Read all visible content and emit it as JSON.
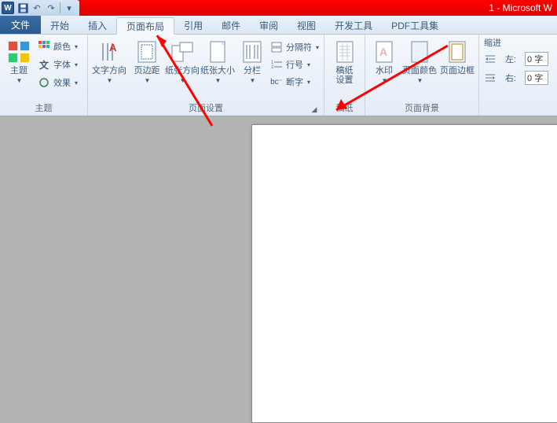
{
  "title": "1 - Microsoft W",
  "tabs": {
    "file": "文件",
    "items": [
      "开始",
      "插入",
      "页面布局",
      "引用",
      "邮件",
      "审阅",
      "视图",
      "开发工具",
      "PDF工具集"
    ],
    "active_index": 2
  },
  "groups": {
    "theme": {
      "label": "主题",
      "main": "主题",
      "colors": "颜色",
      "fonts": "字体",
      "effects": "效果"
    },
    "page_setup": {
      "label": "页面设置",
      "text_direction": "文字方向",
      "margins": "页边距",
      "orientation": "纸张方向",
      "size": "纸张大小",
      "columns": "分栏",
      "breaks": "分隔符",
      "line_numbers": "行号",
      "hyphenation": "断字"
    },
    "paper": {
      "label": "稿纸",
      "settings": "稿纸\n设置"
    },
    "background": {
      "label": "页面背景",
      "watermark": "水印",
      "page_color": "页面颜色",
      "page_border": "页面边框"
    },
    "indent": {
      "title": "缩进",
      "left_label": "左:",
      "right_label": "右:",
      "left_value": "0 字",
      "right_value": "0 字"
    }
  }
}
